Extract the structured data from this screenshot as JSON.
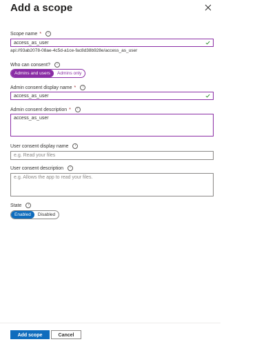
{
  "panel": {
    "title": "Add a scope"
  },
  "scope_name": {
    "label": "Scope name",
    "required_mark": "*",
    "value": "access_as_user",
    "uri": "api://93ab2078-08ae-4c5d-a1ce-fac8d38b928e/access_as_user"
  },
  "who_can_consent": {
    "label": "Who can consent?",
    "options": [
      "Admins and users",
      "Admins only"
    ],
    "selected": "Admins and users"
  },
  "admin_display_name": {
    "label": "Admin consent display name",
    "required_mark": "*",
    "value": "access_as_user"
  },
  "admin_description": {
    "label": "Admin consent description",
    "required_mark": "*",
    "value": "access_as_user"
  },
  "user_display_name": {
    "label": "User consent display name",
    "placeholder": "e.g. Read your files"
  },
  "user_description": {
    "label": "User consent description",
    "placeholder": "e.g. Allows the app to read your files."
  },
  "state": {
    "label": "State",
    "options": [
      "Enabled",
      "Disabled"
    ],
    "selected": "Enabled"
  },
  "footer": {
    "add_label": "Add scope",
    "cancel_label": "Cancel"
  },
  "icons": {
    "close": "close-icon",
    "info": "info-icon",
    "check": "checkmark-icon"
  },
  "colors": {
    "accent_purple": "#8a2da5",
    "primary_blue": "#0f6cbd",
    "valid_green": "#107c10"
  }
}
